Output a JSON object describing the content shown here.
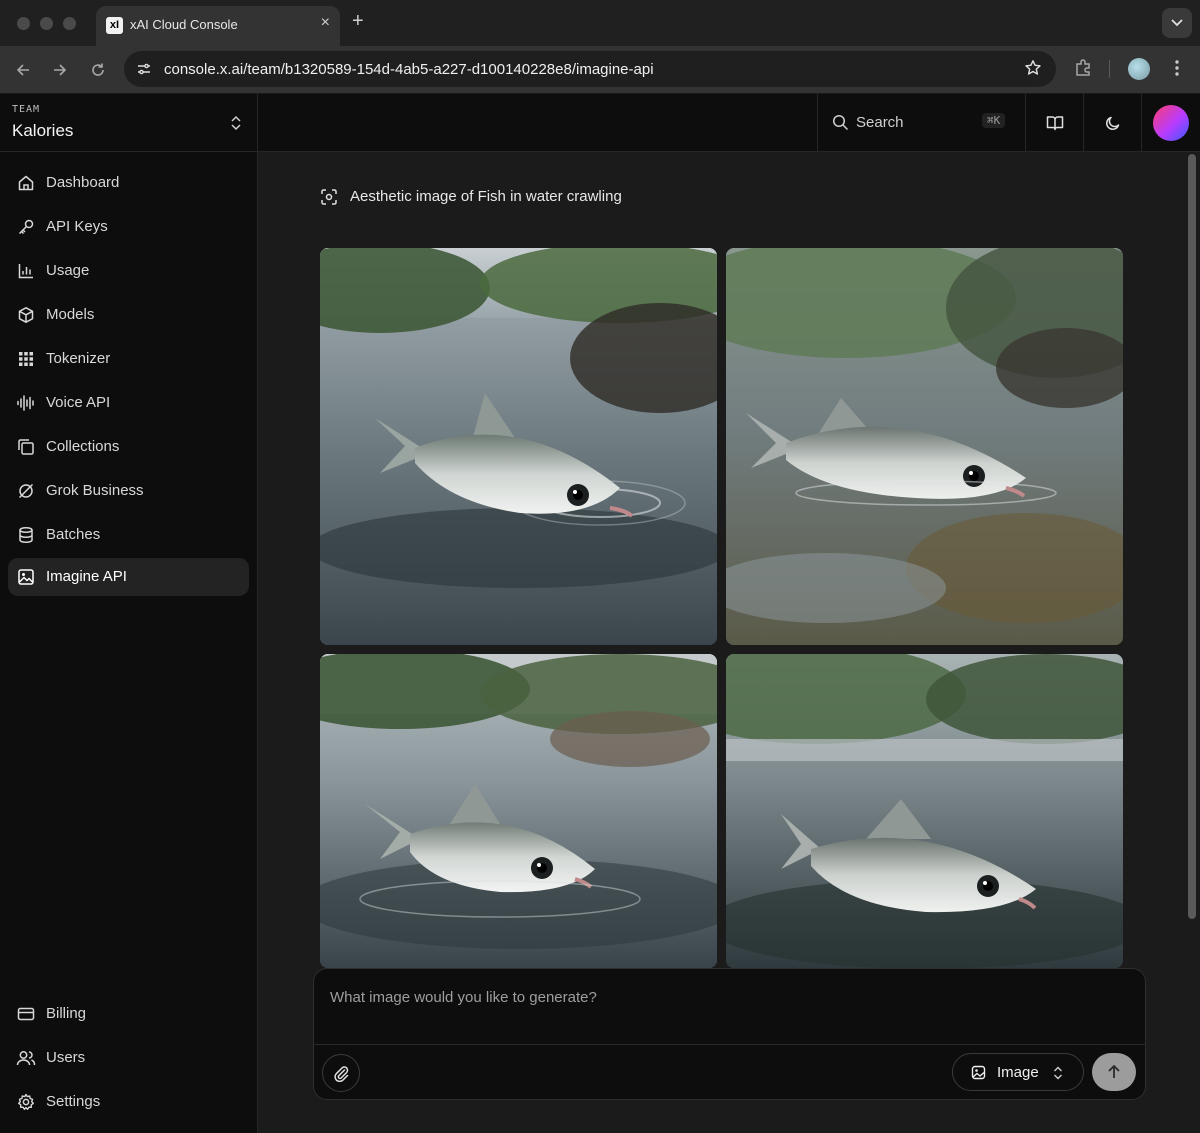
{
  "browser": {
    "tab_title": "xAI Cloud Console",
    "favicon_text": "xI",
    "url": "console.x.ai/team/b1320589-154d-4ab5-a227-d100140228e8/imagine-api"
  },
  "team": {
    "label": "TEAM",
    "name": "Kalories"
  },
  "sidebar": {
    "items": [
      {
        "label": "Dashboard",
        "icon": "home-icon"
      },
      {
        "label": "API Keys",
        "icon": "key-icon"
      },
      {
        "label": "Usage",
        "icon": "bar-chart-icon"
      },
      {
        "label": "Models",
        "icon": "cube-icon"
      },
      {
        "label": "Tokenizer",
        "icon": "grid-icon"
      },
      {
        "label": "Voice API",
        "icon": "waveform-icon"
      },
      {
        "label": "Collections",
        "icon": "collections-icon"
      },
      {
        "label": "Grok Business",
        "icon": "grok-icon"
      },
      {
        "label": "Batches",
        "icon": "database-icon"
      },
      {
        "label": "Imagine API",
        "icon": "image-icon",
        "active": true
      }
    ],
    "bottom_items": [
      {
        "label": "Billing",
        "icon": "credit-card-icon"
      },
      {
        "label": "Users",
        "icon": "users-icon"
      },
      {
        "label": "Settings",
        "icon": "gear-icon"
      }
    ]
  },
  "topbar": {
    "search_label": "Search",
    "search_shortcut": "⌘K",
    "docs_icon": "book-icon",
    "theme_icon": "moon-icon"
  },
  "main": {
    "prompt": "Aesthetic image of Fish in water crawling",
    "images": [
      {
        "name": "generated-image-1",
        "description_icon": "fish-image"
      },
      {
        "name": "generated-image-2",
        "description_icon": "fish-image"
      },
      {
        "name": "generated-image-3",
        "description_icon": "fish-image"
      },
      {
        "name": "generated-image-4",
        "description_icon": "fish-image"
      }
    ]
  },
  "composer": {
    "placeholder": "What image would you like to generate?",
    "mode_label": "Image",
    "attach_icon": "paperclip-icon",
    "send_icon": "arrow-up-icon"
  },
  "colors": {
    "sidebar_bg": "#0d0d0d",
    "main_bg": "#1b1b1b",
    "active_item_bg": "#232323",
    "send_button": "#9c9c9c"
  }
}
